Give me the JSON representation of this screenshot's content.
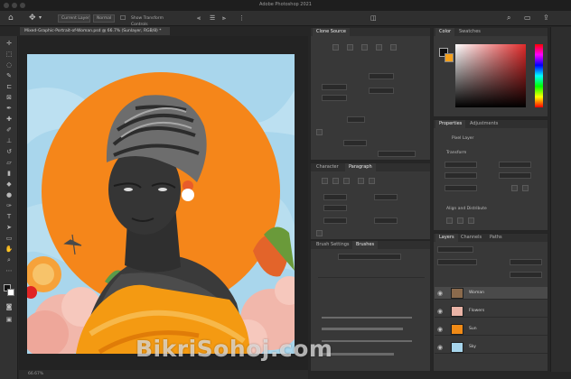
{
  "app": {
    "title": "Adobe Photoshop 2021",
    "document_tab": "Mixed-Graphic-Portrait-of-Woman.psd @ 66.7% (Sunlayer, RGB/8) *",
    "status": "66.67%"
  },
  "options_bar": {
    "sample_field": "Current Layer",
    "mode_field": "Normal",
    "aligned_label": "Show Transform Controls"
  },
  "panels": {
    "clone_source": {
      "tab": "Clone Source"
    },
    "character": {
      "tabs": [
        "Character",
        "Paragraph"
      ]
    },
    "history": {
      "tabs": [
        "Brush Settings",
        "Brushes"
      ]
    },
    "color": {
      "tabs": [
        "Color",
        "Swatches"
      ]
    },
    "properties": {
      "tabs": [
        "Properties",
        "Adjustments"
      ],
      "section_label": "Transform",
      "pixel_layer": "Pixel Layer",
      "align_label": "Align and Distribute"
    },
    "layers": {
      "tabs": [
        "Layers",
        "Channels",
        "Paths"
      ],
      "items": [
        {
          "name": "Woman",
          "thumb_color": "#8a6a4c"
        },
        {
          "name": "Flowers",
          "thumb_color": "#e9b3a6"
        },
        {
          "name": "Sun",
          "thumb_color": "#f08a16"
        },
        {
          "name": "Sky",
          "thumb_color": "#a7d5ec"
        }
      ]
    }
  },
  "colors": {
    "accent_sun": "#f5861a",
    "sky": "#a9d6ec",
    "dress": "#f49a12",
    "flower_pink": "#f1b7ab",
    "foreground_swatch": "#f5a11c"
  },
  "watermark": "BikriSohoj.com"
}
